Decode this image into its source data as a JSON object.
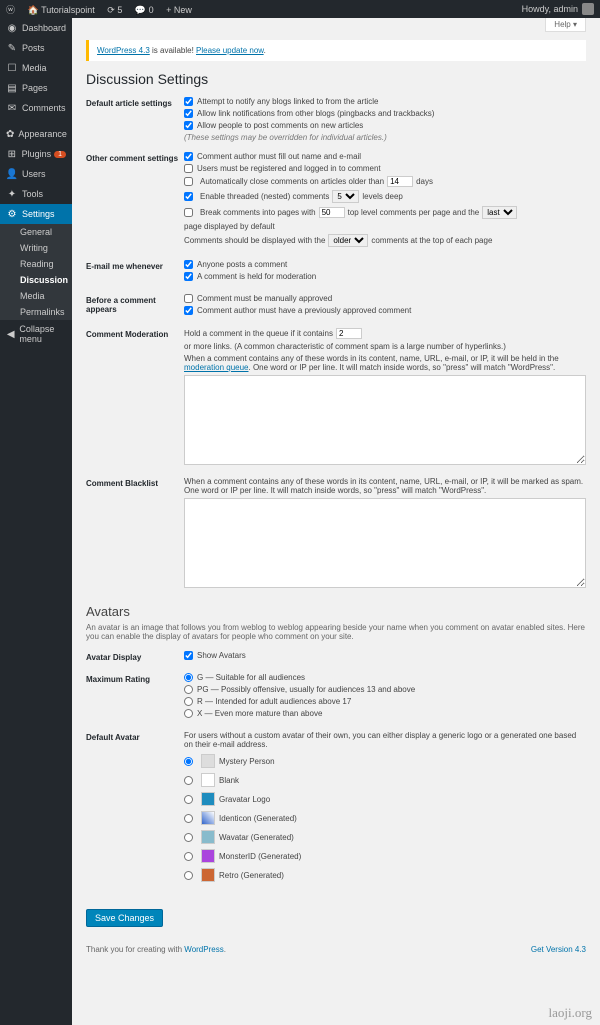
{
  "adminbar": {
    "site": "Tutorialspoint",
    "updates": "5",
    "comments": "0",
    "new": "New",
    "howdy": "Howdy, admin"
  },
  "help": "Help ▾",
  "notice": {
    "pre": "WordPress 4.3",
    "mid": " is available! ",
    "link": "Please update now",
    "suffix": "."
  },
  "title": "Discussion Settings",
  "avatarsHeading": "Avatars",
  "avatarDesc": "An avatar is an image that follows you from weblog to weblog appearing beside your name when you comment on avatar enabled sites. Here you can enable the display of avatars for people who comment on your site.",
  "sidebar": {
    "items": [
      {
        "label": "Dashboard",
        "icon": "◉"
      },
      {
        "label": "Posts",
        "icon": "✎"
      },
      {
        "label": "Media",
        "icon": "☐"
      },
      {
        "label": "Pages",
        "icon": "▤"
      },
      {
        "label": "Comments",
        "icon": "✉"
      },
      {
        "label": "Appearance",
        "icon": "✿"
      },
      {
        "label": "Plugins",
        "icon": "⊞",
        "badge": "1"
      },
      {
        "label": "Users",
        "icon": "👤"
      },
      {
        "label": "Tools",
        "icon": "✦"
      },
      {
        "label": "Settings",
        "icon": "⚙",
        "active": true
      }
    ],
    "sub": [
      "General",
      "Writing",
      "Reading",
      "Discussion",
      "Media",
      "Permalinks"
    ],
    "collapse": "Collapse menu"
  },
  "rows": {
    "defaultArticle": {
      "label": "Default article settings",
      "c1": "Attempt to notify any blogs linked to from the article",
      "c2": "Allow link notifications from other blogs (pingbacks and trackbacks)",
      "c3": "Allow people to post comments on new articles",
      "note": "(These settings may be overridden for individual articles.)"
    },
    "other": {
      "label": "Other comment settings",
      "c1": "Comment author must fill out name and e-mail",
      "c2": "Users must be registered and logged in to comment",
      "c3a": "Automatically close comments on articles older than",
      "c3val": "14",
      "c3b": "days",
      "c4a": "Enable threaded (nested) comments",
      "c4val": "5",
      "c4b": "levels deep",
      "c5a": "Break comments into pages with",
      "c5val": "50",
      "c5b": "top level comments per page and the",
      "c5sel": "last",
      "c5c": "page displayed by default",
      "c6a": "Comments should be displayed with the",
      "c6sel": "older",
      "c6b": "comments at the top of each page"
    },
    "email": {
      "label": "E-mail me whenever",
      "c1": "Anyone posts a comment",
      "c2": "A comment is held for moderation"
    },
    "before": {
      "label": "Before a comment appears",
      "c1": "Comment must be manually approved",
      "c2": "Comment author must have a previously approved comment"
    },
    "moderation": {
      "label": "Comment Moderation",
      "text1a": "Hold a comment in the queue if it contains",
      "val": "2",
      "text1b": "or more links. (A common characteristic of comment spam is a large number of hyperlinks.)",
      "text2a": "When a comment contains any of these words in its content, name, URL, e-mail, or IP, it will be held in the ",
      "link": "moderation queue",
      "text2b": ". One word or IP per line. It will match inside words, so \"press\" will match \"WordPress\"."
    },
    "blacklist": {
      "label": "Comment Blacklist",
      "text": "When a comment contains any of these words in its content, name, URL, e-mail, or IP, it will be marked as spam. One word or IP per line. It will match inside words, so \"press\" will match \"WordPress\"."
    },
    "avatarDisplay": {
      "label": "Avatar Display",
      "c1": "Show Avatars"
    },
    "rating": {
      "label": "Maximum Rating",
      "r1": "G — Suitable for all audiences",
      "r2": "PG — Possibly offensive, usually for audiences 13 and above",
      "r3": "R — Intended for adult audiences above 17",
      "r4": "X — Even more mature than above"
    },
    "defaultAvatar": {
      "label": "Default Avatar",
      "desc": "For users without a custom avatar of their own, you can either display a generic logo or a generated one based on their e-mail address.",
      "o1": "Mystery Person",
      "o2": "Blank",
      "o3": "Gravatar Logo",
      "o4": "Identicon (Generated)",
      "o5": "Wavatar (Generated)",
      "o6": "MonsterID (Generated)",
      "o7": "Retro (Generated)"
    }
  },
  "save": "Save Changes",
  "footer": {
    "left1": "Thank you for creating with ",
    "left2": "WordPress",
    "left3": ".",
    "right": "Get Version 4.3"
  },
  "watermark": "laoji.org"
}
